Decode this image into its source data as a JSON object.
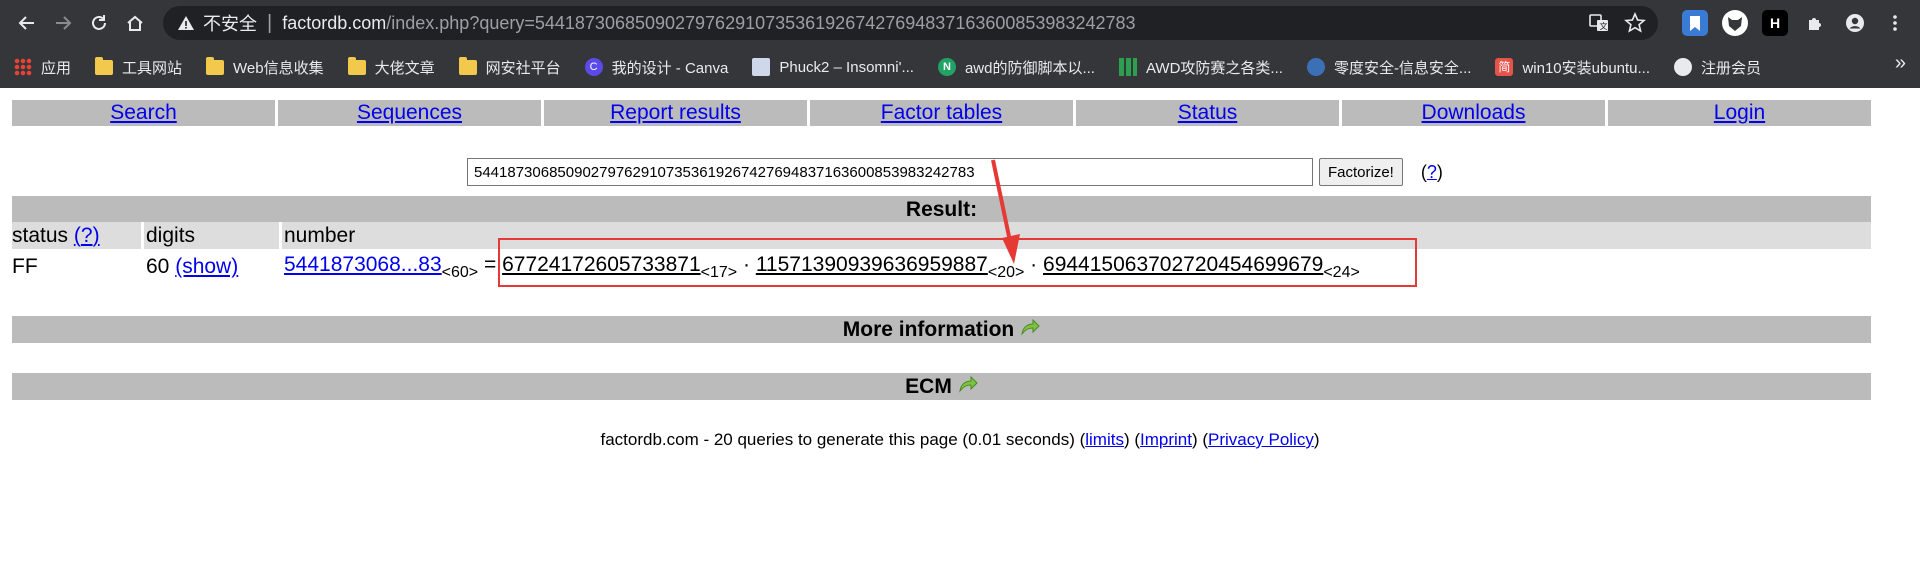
{
  "browser": {
    "insecure_label": "不安全",
    "url_host": "factordb.com",
    "url_path": "/index.php?query=544187306850902797629107353619267427694837163600853983242783",
    "bookmarks": [
      {
        "label": "应用",
        "icon": "apps-grid-icon"
      },
      {
        "label": "工具网站",
        "icon": "folder-icon"
      },
      {
        "label": "Web信息收集",
        "icon": "folder-icon"
      },
      {
        "label": "大佬文章",
        "icon": "folder-icon"
      },
      {
        "label": "网安社平台",
        "icon": "folder-icon"
      },
      {
        "label": "我的设计 - Canva",
        "icon": "canva-icon"
      },
      {
        "label": "Phuck2 – Insomni'...",
        "icon": "page-icon"
      },
      {
        "label": "awd的防御脚本以...",
        "icon": "n-icon"
      },
      {
        "label": "AWD攻防赛之各类...",
        "icon": "green-bars-icon"
      },
      {
        "label": "零度安全-信息安全...",
        "icon": "gear-icon"
      },
      {
        "label": "win10安装ubuntu...",
        "icon": "jian-icon"
      },
      {
        "label": "注册会员",
        "icon": "globe-icon"
      }
    ],
    "jian_char": "简",
    "canva_char": "C",
    "n_char": "N"
  },
  "nav": {
    "items": [
      "Search",
      "Sequences",
      "Report results",
      "Factor tables",
      "Status",
      "Downloads",
      "Login"
    ]
  },
  "search": {
    "query": "544187306850902797629107353619267427694837163600853983242783",
    "button_label": "Factorize!",
    "help": "?"
  },
  "result": {
    "title": "Result:",
    "headers": {
      "status": "status",
      "help": "?",
      "digits": "digits",
      "number": "number"
    },
    "row": {
      "status": "FF",
      "digits": "60",
      "show_label": "(show)",
      "number_short": "5441873068...83",
      "number_digits": "<60>",
      "equals": "=",
      "factors": [
        {
          "value": "67724172605733871",
          "digits": "<17>"
        },
        {
          "value": "11571390939636959887",
          "digits": "<20>"
        },
        {
          "value": "694415063702720454699679",
          "digits": "<24>"
        }
      ],
      "dot": "·"
    }
  },
  "more_information": "More information",
  "ecm": "ECM",
  "footer": {
    "text": "factordb.com - 20 queries to generate this page (0.01 seconds)",
    "links": [
      "limits",
      "Imprint",
      "Privacy Policy"
    ]
  },
  "colors": {
    "annotation_red": "#e53935",
    "link": "#0000ee",
    "bar": "#bbbbbb"
  }
}
